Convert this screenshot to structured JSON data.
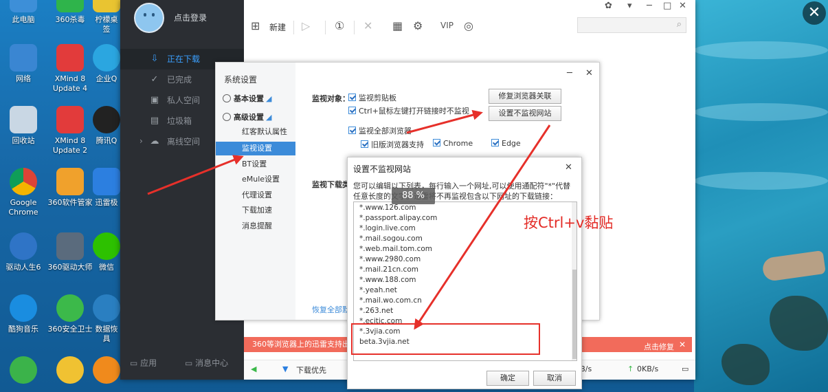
{
  "desktop": {
    "icons": [
      {
        "id": "desktop-icon-this-pc",
        "label": "此电脑"
      },
      {
        "id": "desktop-icon-360-antivirus",
        "label": "360杀毒"
      },
      {
        "id": "desktop-icon-lemon",
        "label": "柠檬桌\n签"
      },
      {
        "id": "desktop-icon-network",
        "label": "网络"
      },
      {
        "id": "desktop-icon-xmind-4",
        "label": "XMind 8\nUpdate 4"
      },
      {
        "id": "desktop-icon-enterprise",
        "label": "企业Q"
      },
      {
        "id": "desktop-icon-recycle-bin",
        "label": "回收站"
      },
      {
        "id": "desktop-icon-xmind-2",
        "label": "XMind 8\nUpdate 2"
      },
      {
        "id": "desktop-icon-tencent-qq",
        "label": "腾讯Q"
      },
      {
        "id": "desktop-icon-chrome",
        "label": "Google\nChrome"
      },
      {
        "id": "desktop-icon-360-software",
        "label": "360软件管家"
      },
      {
        "id": "desktop-icon-xunlei",
        "label": "迅雷极"
      },
      {
        "id": "desktop-icon-driver-genius",
        "label": "驱动人生6"
      },
      {
        "id": "desktop-icon-360-driver",
        "label": "360驱动大师"
      },
      {
        "id": "desktop-icon-wechat",
        "label": "微信"
      },
      {
        "id": "desktop-icon-kugou",
        "label": "酷狗音乐"
      },
      {
        "id": "desktop-icon-360-safe",
        "label": "360安全卫士"
      },
      {
        "id": "desktop-icon-data-recovery",
        "label": "数据恢\n具"
      }
    ]
  },
  "thunder": {
    "login": "点击登录",
    "nav": {
      "downloading": "正在下载",
      "completed": "已完成",
      "private": "私人空间",
      "trash": "垃圾箱",
      "offline": "离线空间"
    },
    "footer": {
      "apps": "应用",
      "messages": "消息中心"
    },
    "toolbar": {
      "new": "新建"
    },
    "banner": {
      "text": "360等浏览器上的迅雷支持出问",
      "fix": "点击修复"
    },
    "status": {
      "priority": "下载优先",
      "down_speed": "0KB/s",
      "up_speed": "0KB/s"
    }
  },
  "settings": {
    "title": "系统设置",
    "cat_basic": "基本设置",
    "cat_advanced": "高级设置",
    "subs": [
      "红客默认属性",
      "监视设置",
      "BT设置",
      "eMule设置",
      "代理设置",
      "下载加速",
      "消息提醒"
    ],
    "monitor_label": "监视对象：",
    "monitor_download_label": "监视下载类",
    "chk_clipboard": "监视剪贴板",
    "chk_ctrl": "Ctrl+鼠标左键打开链接时不监视",
    "chk_all_browsers": "监视全部浏览器",
    "chk_old_browser": "旧版浏览器支持",
    "chk_chrome": "Chrome",
    "chk_edge": "Edge",
    "btn_repair": "修复浏览器关联",
    "btn_no_monitor": "设置不监视网站",
    "restore": "恢复全部默"
  },
  "popup": {
    "title": "设置不监视网站",
    "desc": "您可以编辑以下列表，每行输入一个网址,可以使用通配符\"*\"代替任意长度的文字。迅雷将不再监视包含以下网址的下载链接：",
    "percent": "88 %",
    "sites": [
      "*.www.126.com",
      "*.passport.alipay.com",
      "*.login.live.com",
      "*.mail.sogou.com",
      "*.web.mail.tom.com",
      "*.www.2980.com",
      "*.mail.21cn.com",
      "*.www.188.com",
      "*.yeah.net",
      "*.mail.wo.com.cn",
      "*.263.net",
      "*.ecitic.com",
      "*.3vjia.com",
      "beta.3vjia.net"
    ],
    "ok": "确定",
    "cancel": "取消"
  },
  "annotation": "按Ctrl+v黏贴"
}
